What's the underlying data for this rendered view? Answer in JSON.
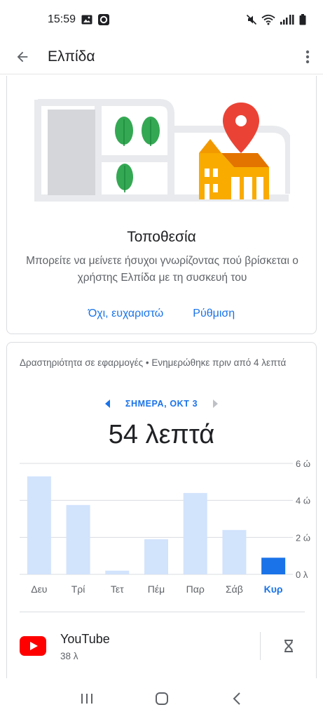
{
  "status_bar": {
    "time": "15:59",
    "icons": [
      "gallery-icon",
      "camera-icon",
      "mute-icon",
      "wifi-icon",
      "signal-icon",
      "battery-icon"
    ]
  },
  "app_bar": {
    "title": "Ελπίδα",
    "back_icon": "arrow-back-icon",
    "menu_icon": "more-vert-icon"
  },
  "location_card": {
    "title": "Τοποθεσία",
    "description": "Μπορείτε να μείνετε ήσυχοι γνωρίζοντας πού βρίσκεται ο χρήστης Ελπίδα με τη συσκευή του",
    "decline_label": "Όχι, ευχαριστώ",
    "setup_label": "Ρύθμιση"
  },
  "activity_card": {
    "header": "Δραστηριότητα σε εφαρμογές • Ενημερώθηκε πριν από 4 λεπτά",
    "date_label": "ΣΗΜΕΡΑ, ΟΚΤ 3",
    "total": "54 λεπτά"
  },
  "chart_data": {
    "type": "bar",
    "categories": [
      "Δευ",
      "Τρί",
      "Τετ",
      "Πέμ",
      "Παρ",
      "Σάβ",
      "Κυρ"
    ],
    "values": [
      5.3,
      3.75,
      0.2,
      1.9,
      4.4,
      2.4,
      0.9
    ],
    "unit": "hours",
    "y_ticks": [
      "0 λ",
      "2 ώ",
      "4 ώ",
      "6 ώ"
    ],
    "ylim": [
      0,
      6
    ],
    "highlight_index": 6,
    "colors": {
      "bar": "#d2e3fc",
      "highlight": "#1a73e8",
      "grid": "#dadce0"
    }
  },
  "apps": [
    {
      "name": "YouTube",
      "time": "38 λ",
      "icon": "youtube-icon",
      "action_icon": "hourglass-icon"
    }
  ],
  "colors": {
    "accent": "#1a73e8",
    "text_primary": "#202124",
    "text_secondary": "#5f6368"
  }
}
